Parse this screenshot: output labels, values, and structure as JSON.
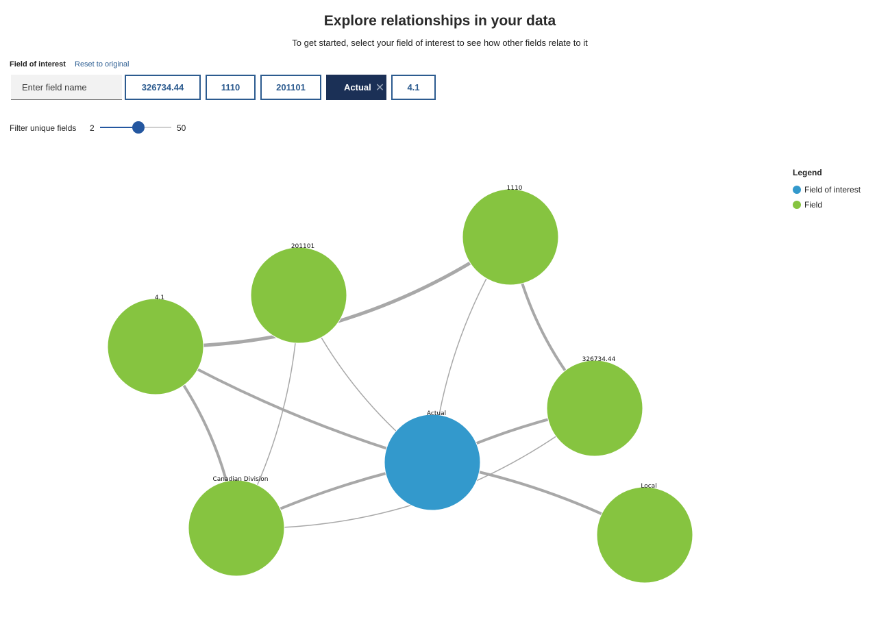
{
  "header": {
    "title": "Explore relationships in your data",
    "subtitle": "To get started, select your field of interest to see how other fields relate to it"
  },
  "controls": {
    "field_of_interest_label": "Field of interest",
    "reset_label": "Reset to original",
    "input_placeholder": "Enter field name",
    "chips": [
      {
        "label": "326734.44",
        "active": false
      },
      {
        "label": "1110",
        "active": false
      },
      {
        "label": "201101",
        "active": false
      },
      {
        "label": "Actual",
        "active": true
      },
      {
        "label": "4.1",
        "active": false
      }
    ],
    "close_icon": "close-icon",
    "filter": {
      "label": "Filter unique fields",
      "min": 2,
      "max": 50,
      "value": 28
    }
  },
  "legend": {
    "title": "Legend",
    "items": [
      {
        "label": "Field of interest",
        "color": "#3399cc"
      },
      {
        "label": "Field",
        "color": "#86c440"
      }
    ]
  },
  "colors": {
    "field_of_interest": "#3399cc",
    "field": "#86c440",
    "edge": "#a8a8a8",
    "accent": "#2c5b8f"
  },
  "graph": {
    "nodes": [
      {
        "id": "actual",
        "label": "Actual",
        "type": "field_of_interest"
      },
      {
        "id": "1110",
        "label": "1110",
        "type": "field"
      },
      {
        "id": "201101",
        "label": "201101",
        "type": "field"
      },
      {
        "id": "4.1",
        "label": "4.1",
        "type": "field"
      },
      {
        "id": "326734.44",
        "label": "326734.44",
        "type": "field"
      },
      {
        "id": "canadian",
        "label": "Canadian Division",
        "type": "field"
      },
      {
        "id": "local",
        "label": "Local",
        "type": "field"
      }
    ],
    "edges": [
      {
        "source": "4.1",
        "target": "1110",
        "strength": "strong"
      },
      {
        "source": "4.1",
        "target": "actual",
        "strength": "medium"
      },
      {
        "source": "4.1",
        "target": "canadian",
        "strength": "medium"
      },
      {
        "source": "201101",
        "target": "actual",
        "strength": "weak"
      },
      {
        "source": "201101",
        "target": "canadian",
        "strength": "weak"
      },
      {
        "source": "1110",
        "target": "actual",
        "strength": "weak"
      },
      {
        "source": "1110",
        "target": "326734.44",
        "strength": "medium"
      },
      {
        "source": "326734.44",
        "target": "actual",
        "strength": "medium"
      },
      {
        "source": "326734.44",
        "target": "canadian",
        "strength": "weak"
      },
      {
        "source": "canadian",
        "target": "actual",
        "strength": "medium"
      },
      {
        "source": "actual",
        "target": "local",
        "strength": "medium"
      }
    ]
  }
}
